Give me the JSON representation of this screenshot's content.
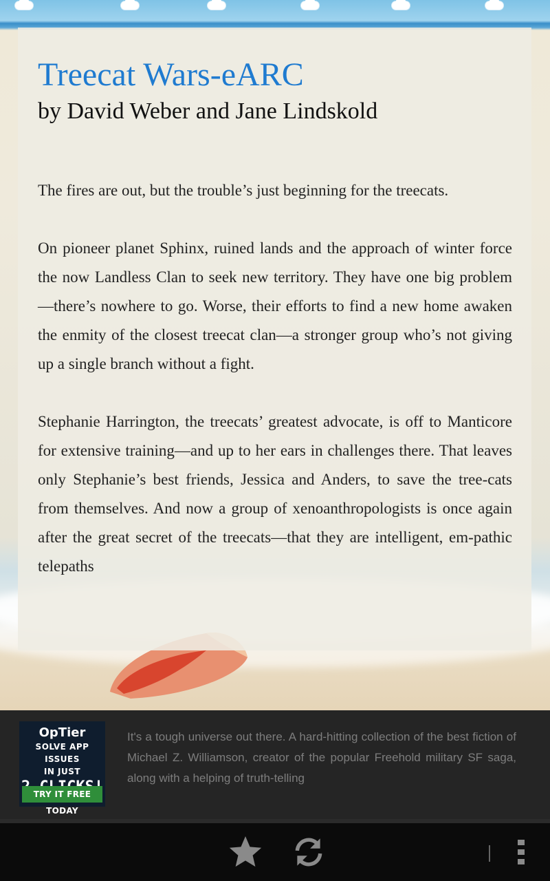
{
  "book": {
    "title": "Treecat Wars-eARC",
    "author": "by David Weber and Jane Lindskold",
    "description": [
      "The fires are out, but the trouble’s just beginning for the treecats.",
      "On pioneer planet Sphinx, ruined lands and the approach of winter force the now Landless Clan to seek new territory. They have one big problem—there’s nowhere to go.  Worse, their efforts to find a new home awaken the enmity of the closest treecat clan—a stronger group who’s not giving up a single branch without a fight.",
      "Stephanie Harrington, the treecats’ greatest advocate, is off to Manticore for extensive training—and up to her ears in challenges there.  That leaves only Stephanie’s best friends, Jessica and Anders, to save the tree-cats from themselves.  And now a group of xenoanthropologists is once again after the great secret of the treecats—that they are intelligent, em-pathic telepaths"
    ]
  },
  "ad": {
    "brand": "OpTier",
    "line1": "SOLVE APP ISSUES",
    "line2": "IN JUST",
    "big": "2 CLICKS!",
    "cta": "TRY IT FREE TODAY"
  },
  "promo": {
    "text": "It's a tough universe out there. A hard-hitting collection of the best fiction of Michael Z. Williamson, creator of the popular Freehold military SF saga, along with a helping of truth-telling"
  },
  "navbar": {
    "icons": [
      "star-icon",
      "refresh-icon",
      "overflow-menu-icon"
    ]
  },
  "colors": {
    "title": "#1f7bd0",
    "ad_cta": "#2f8e3a"
  }
}
